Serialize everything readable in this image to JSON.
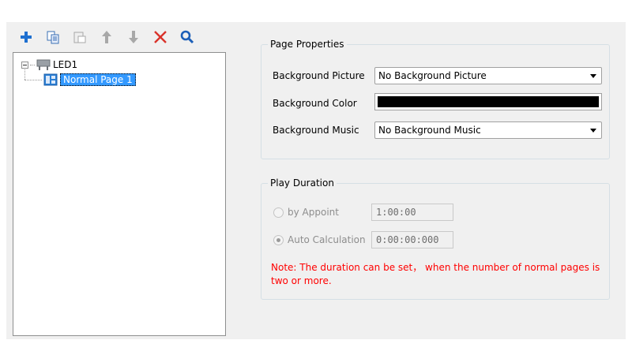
{
  "toolbar": {
    "buttons": [
      {
        "icon": "plus-icon"
      },
      {
        "icon": "copy-icon"
      },
      {
        "icon": "paste-icon"
      },
      {
        "icon": "arrow-up-icon"
      },
      {
        "icon": "arrow-down-icon"
      },
      {
        "icon": "delete-x-icon"
      },
      {
        "icon": "search-icon"
      }
    ],
    "colors": {
      "plus": "#1e6fd0",
      "delete": "#d9322a",
      "search": "#1c5fb8",
      "disabled": "#a8a8a8"
    }
  },
  "tree": {
    "root": {
      "label": "LED1",
      "icon": "led-screen-icon"
    },
    "child": {
      "label": "Normal Page 1",
      "icon": "page-layout-icon",
      "selected": true
    }
  },
  "page_properties": {
    "title": "Page Properties",
    "background_picture": {
      "label": "Background Picture",
      "value": "No Background Picture"
    },
    "background_color": {
      "label": "Background Color",
      "value": "#000000"
    },
    "background_music": {
      "label": "Background Music",
      "value": "No Background Music"
    }
  },
  "play_duration": {
    "title": "Play Duration",
    "by_appoint": {
      "label": "by Appoint",
      "value": "1:00:00",
      "checked": false
    },
    "auto_calculation": {
      "label": "Auto Calculation",
      "value": "0:00:00:000",
      "checked": true
    },
    "note": "Note: The duration can be set， when the number of normal pages is two or more.",
    "note_color": "#ff0000"
  }
}
